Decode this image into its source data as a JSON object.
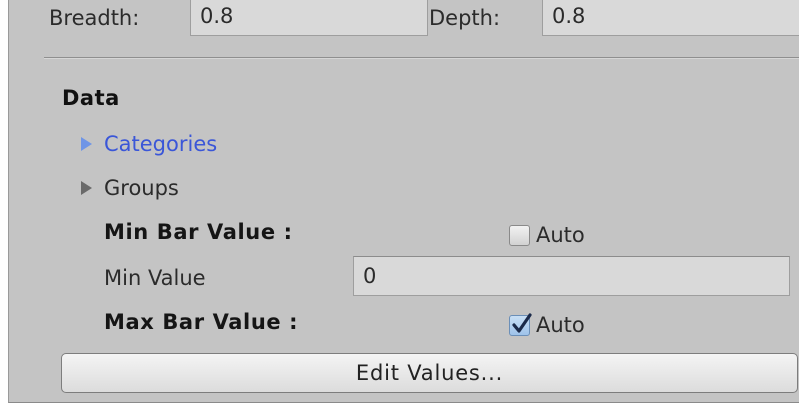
{
  "dimensions": {
    "breadth_label": "Breadth:",
    "breadth_value": "0.8",
    "depth_label": "Depth:",
    "depth_value": "0.8"
  },
  "data_section": {
    "header": "Data",
    "foldouts": [
      {
        "label": "Categories",
        "active": true
      },
      {
        "label": "Groups",
        "active": false
      }
    ],
    "min_bar_label": "Min Bar Value :",
    "min_bar_auto": {
      "label": "Auto",
      "checked": false
    },
    "min_value_label": "Min Value",
    "min_value": "0",
    "max_bar_label": "Max Bar Value :",
    "max_bar_auto": {
      "label": "Auto",
      "checked": true
    },
    "edit_button": "Edit Values..."
  },
  "colors": {
    "panel_bg": "#c4c4c4",
    "field_bg": "#d9d9d9",
    "active_foldout": "#3a56d8",
    "checkbox_checked": "#9fc3ea"
  }
}
